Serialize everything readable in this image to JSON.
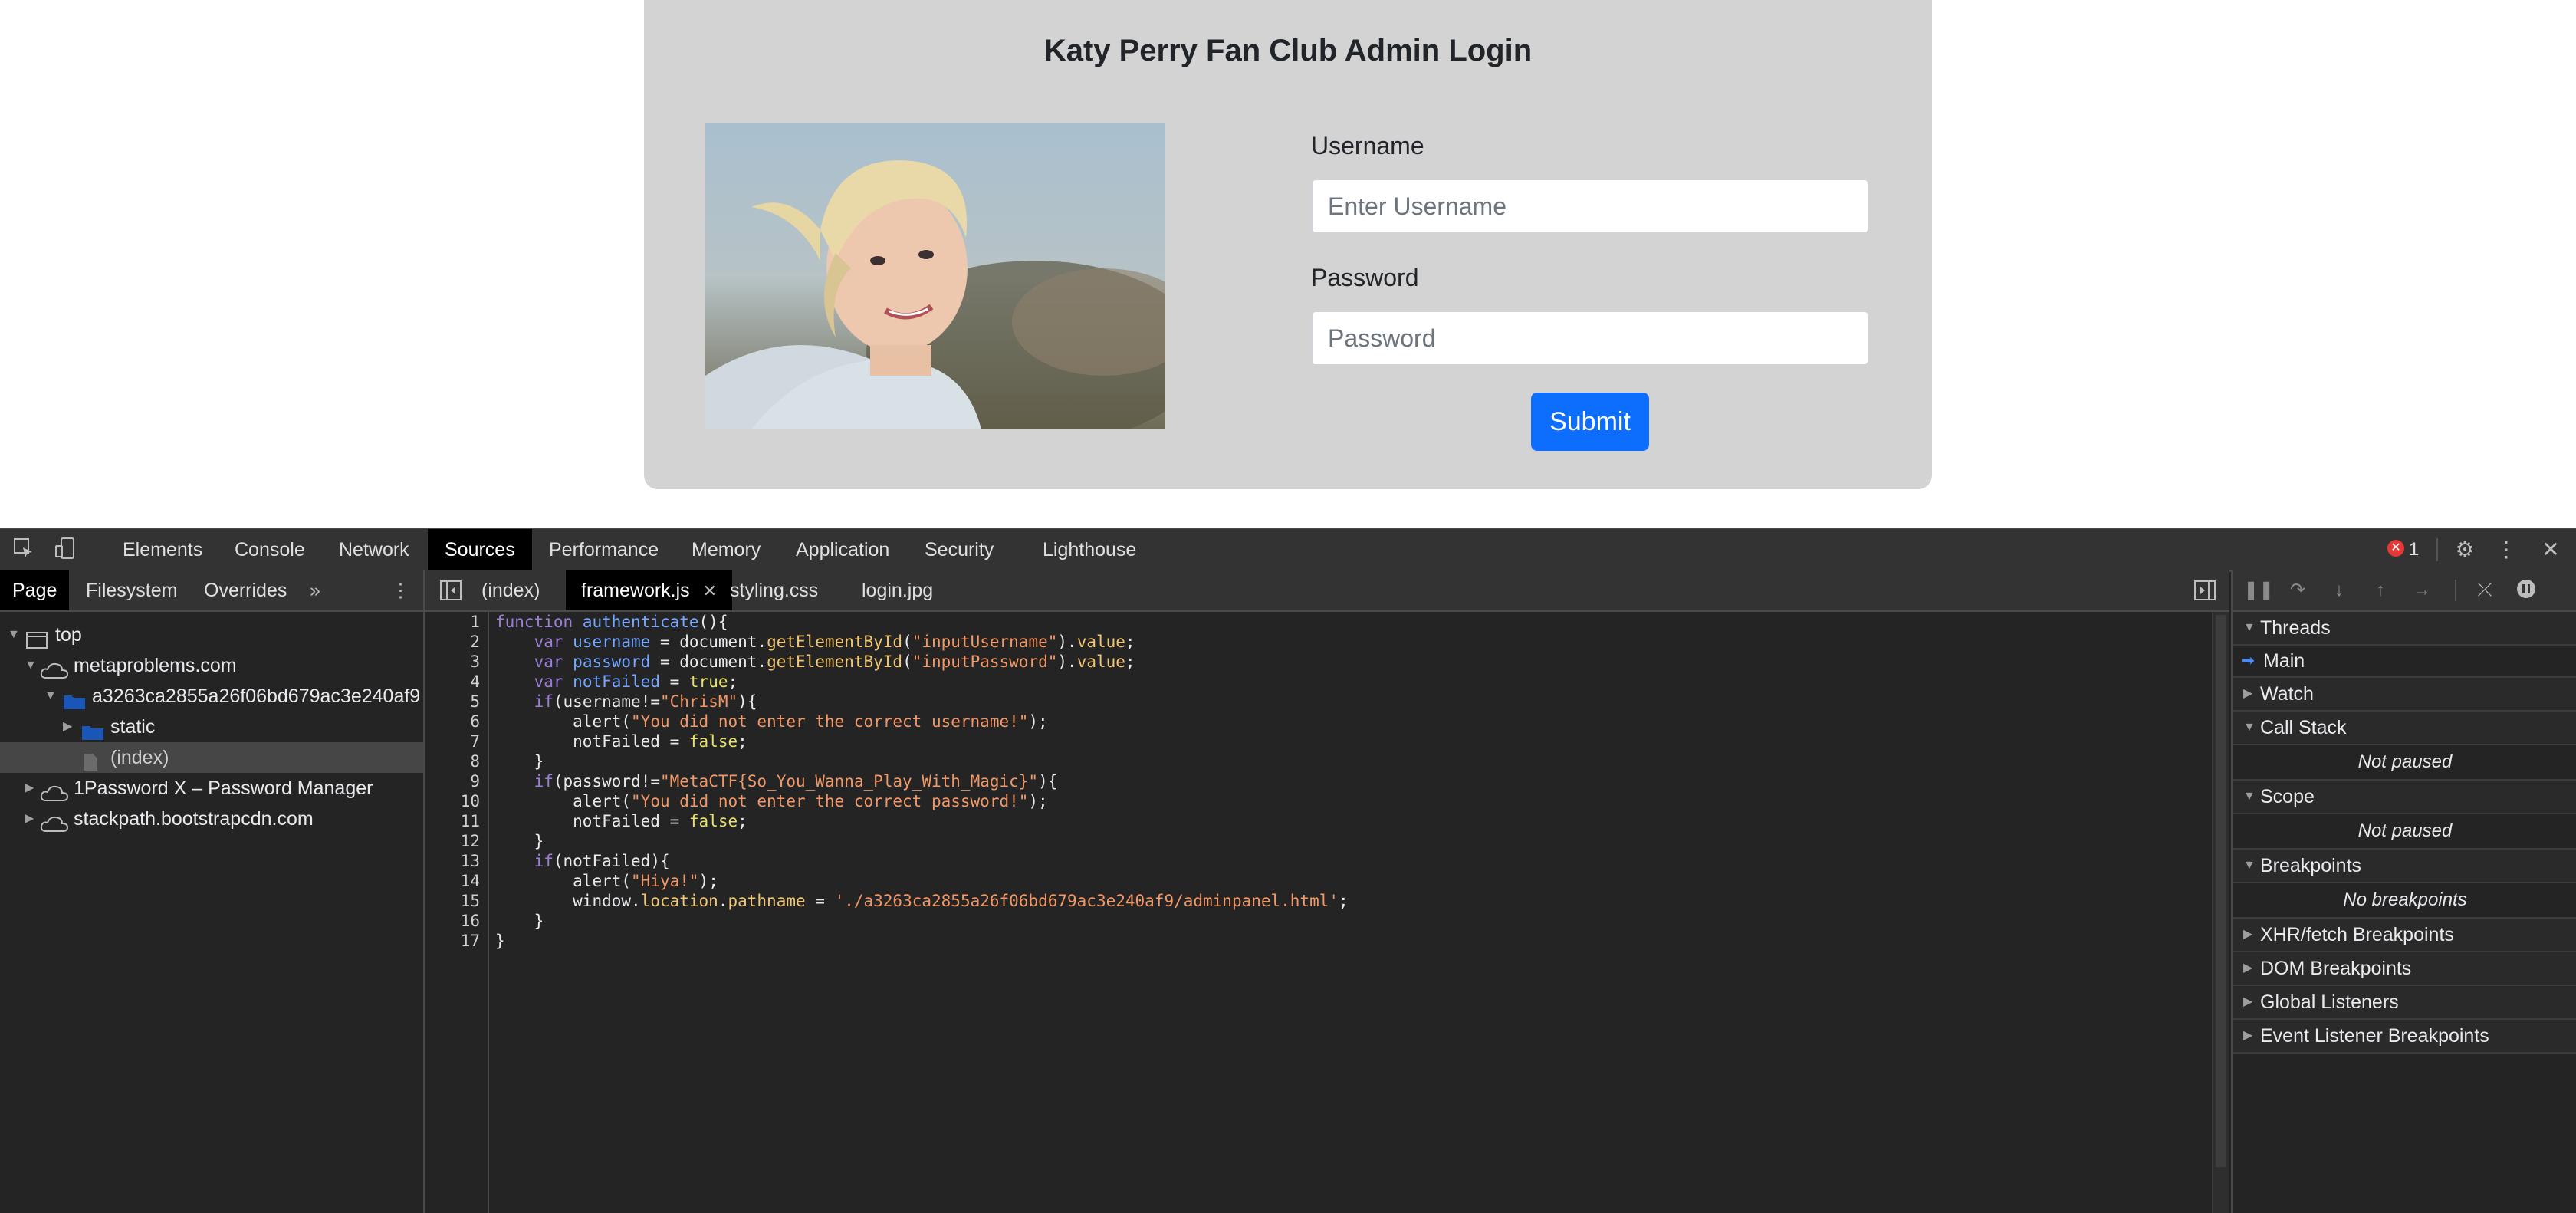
{
  "login": {
    "title": "Katy Perry Fan Club Admin Login",
    "username_label": "Username",
    "username_placeholder": "Enter Username",
    "password_label": "Password",
    "password_placeholder": "Password",
    "submit_label": "Submit"
  },
  "devtools": {
    "tabs": [
      "Elements",
      "Console",
      "Network",
      "Sources",
      "Performance",
      "Memory",
      "Application",
      "Security",
      "Lighthouse"
    ],
    "error_count": "1",
    "nav_tabs": [
      "Page",
      "Filesystem",
      "Overrides"
    ],
    "tree": [
      "top",
      "metaproblems.com",
      "a3263ca2855a26f06bd679ac3e240af9",
      "static",
      "(index)",
      "1Password X – Password Manager",
      "stackpath.bootstrapcdn.com"
    ],
    "file_tabs": [
      "(index)",
      "framework.js",
      "styling.css",
      "login.jpg"
    ],
    "line_numbers": [
      "1",
      "2",
      "3",
      "4",
      "5",
      "6",
      "7",
      "8",
      "9",
      "10",
      "11",
      "12",
      "13",
      "14",
      "15",
      "16",
      "17"
    ],
    "code": {
      "kw_function": "function",
      "fn_authenticate": "authenticate",
      "paren_open": "(){",
      "kw_var": "var",
      "v_username": "username",
      "v_password": "password",
      "v_notFailed": "notFailed",
      "eq": " = ",
      "document": "document.",
      "getById": "getElementById",
      "str_inputUsername": "\"inputUsername\"",
      "str_inputPassword": "\"inputPassword\"",
      "value": "value",
      "true": "true",
      "false": "false",
      "kw_if": "if",
      "neq": "!=",
      "str_chris": "\"ChrisM\"",
      "str_flag": "\"MetaCTF{So_You_Wanna_Play_With_Magic}\"",
      "alert": "alert",
      "str_alert_user": "\"You did not enter the correct username!\"",
      "str_alert_pass": "\"You did not enter the correct password!\"",
      "str_hiya": "\"Hiya!\"",
      "window": "window.",
      "location": "location",
      "pathname": "pathname",
      "str_path": "'./a3263ca2855a26f06bd679ac3e240af9/adminpanel.html'"
    },
    "debugger": {
      "threads_label": "Threads",
      "main_thread": "Main",
      "watch_label": "Watch",
      "callstack_label": "Call Stack",
      "callstack_status": "Not paused",
      "scope_label": "Scope",
      "scope_status": "Not paused",
      "breakpoints_label": "Breakpoints",
      "breakpoints_status": "No breakpoints",
      "xhr_label": "XHR/fetch Breakpoints",
      "dom_label": "DOM Breakpoints",
      "global_label": "Global Listeners",
      "event_label": "Event Listener Breakpoints"
    }
  }
}
